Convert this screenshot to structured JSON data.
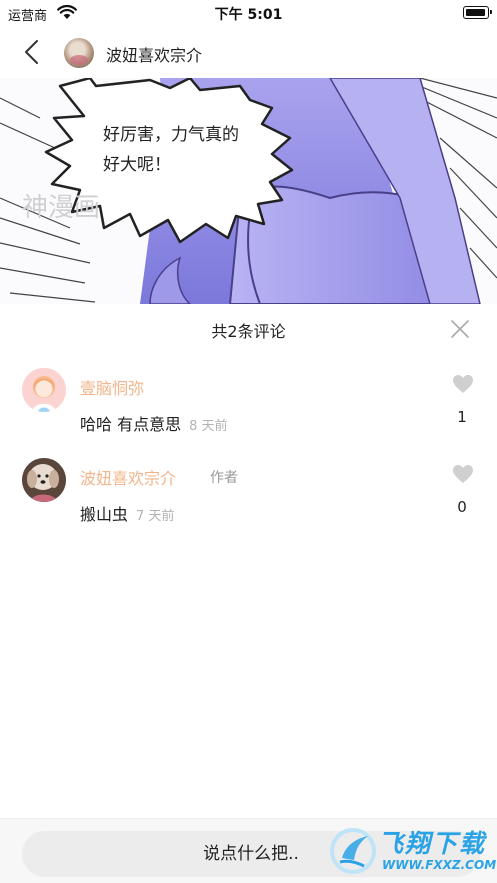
{
  "status_bar": {
    "carrier": "运营商",
    "time": "下午 5:01"
  },
  "nav": {
    "title": "波妞喜欢宗介"
  },
  "comic": {
    "speech_line1": "好厉害，力气真的",
    "speech_line2": "好大呢！",
    "watermark": "神漫画"
  },
  "comments": {
    "header": "共2条评论",
    "items": [
      {
        "user": "壹脑恫弥",
        "role": "",
        "text": "哈哈 有点意思",
        "time": "8 天前",
        "likes": "1",
        "avatar": "girl-avatar"
      },
      {
        "user": "波妞喜欢宗介",
        "role": "作者",
        "text": "搬山虫",
        "time": "7 天前",
        "likes": "0",
        "avatar": "dog-avatar"
      }
    ]
  },
  "input": {
    "placeholder": "说点什么把.."
  },
  "site_logo": {
    "main": "飞翔下载",
    "sub": "WWW.FXXZ.COM"
  },
  "colors": {
    "username": "#f2b48a",
    "muted": "#b3b3b3",
    "comic_purple": "#8b87e0",
    "logo_blue": "#2aa3e6"
  },
  "icons": [
    "wifi-icon",
    "battery-icon",
    "back-arrow-icon",
    "close-icon",
    "heart-icon"
  ]
}
